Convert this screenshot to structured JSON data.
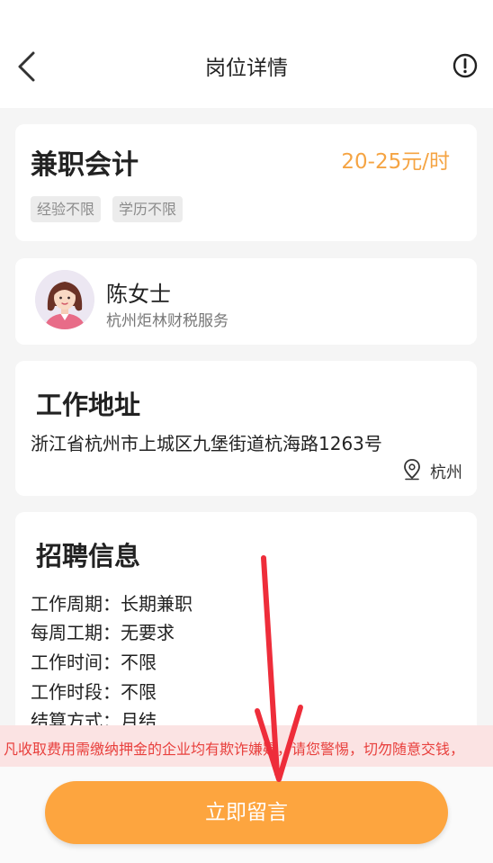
{
  "header": {
    "title": "岗位详情",
    "back_icon": "chevron-left-icon",
    "info_icon": "info-circle-icon"
  },
  "job": {
    "title": "兼职会计",
    "salary": "20-25元/时",
    "tags": [
      "经验不限",
      "学历不限"
    ]
  },
  "contact": {
    "name": "陈女士",
    "company": "杭州炬林财税服务"
  },
  "address": {
    "heading": "工作地址",
    "text": "浙江省杭州市上城区九堡街道杭海路1263号",
    "city": "杭州"
  },
  "recruitment": {
    "heading": "招聘信息",
    "rows": [
      {
        "label": "工作周期：",
        "value": "长期兼职"
      },
      {
        "label": "每周工期：",
        "value": "无要求"
      },
      {
        "label": "工作时间：",
        "value": "不限"
      },
      {
        "label": "工作时段：",
        "value": "不限"
      },
      {
        "label": "结算方式：",
        "value": "月结"
      }
    ]
  },
  "warning": "凡收取费用需缴纳押金的企业均有欺诈嫌疑，请您警惕，切勿随意交钱，",
  "cta_label": "立即留言",
  "colors": {
    "accent": "#fda53f",
    "salary": "#f5a443",
    "warning_text": "#e8403d",
    "warning_bg": "#fbe3e3"
  }
}
